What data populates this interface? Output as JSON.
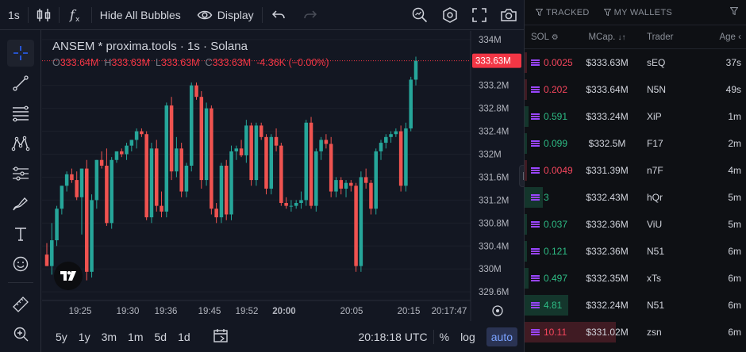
{
  "topbar": {
    "interval": "1s",
    "hide_bubbles": "Hide All Bubbles",
    "display": "Display"
  },
  "legend": {
    "title": "ANSEM * proxima.tools · 1s · Solana",
    "o_label": "O",
    "o_value": "333.64M",
    "h_label": "H",
    "h_value": "333.63M",
    "l_label": "L",
    "l_value": "333.63M",
    "c_label": "C",
    "c_value": "333.63M",
    "change": "-4.36K (−0.00%)"
  },
  "price_axis": {
    "labels": [
      "334M",
      "333.2M",
      "332.8M",
      "332.4M",
      "332M",
      "331.6M",
      "331.2M",
      "330.8M",
      "330.4M",
      "330M",
      "329.6M"
    ],
    "current": "333.63M"
  },
  "time_axis": {
    "labels": [
      "19:25",
      "19:30",
      "19:36",
      "19:45",
      "19:52",
      "20:00",
      "20:05",
      "20:15",
      "20:17:47"
    ]
  },
  "bottombar": {
    "ranges": [
      "5y",
      "1y",
      "3m",
      "1m",
      "5d",
      "1d"
    ],
    "clock": "20:18:18 UTC",
    "percent": "%",
    "log": "log",
    "auto": "auto"
  },
  "panel": {
    "tab_tracked": "TRACKED",
    "tab_wallets": "MY WALLETS",
    "col_sol": "SOL",
    "col_mcap": "MCap.",
    "col_trader": "Trader",
    "col_age": "Age",
    "trades": [
      {
        "sol": "0.0025",
        "mcap": "$333.63M",
        "trader": "sEQ",
        "age": "37s",
        "side": "sell",
        "bar": 0.0
      },
      {
        "sol": "0.202",
        "mcap": "$333.64M",
        "trader": "N5N",
        "age": "49s",
        "side": "sell",
        "bar": 0.0
      },
      {
        "sol": "0.591",
        "mcap": "$333.24M",
        "trader": "XiP",
        "age": "1m",
        "side": "buy",
        "bar": 0.02
      },
      {
        "sol": "0.099",
        "mcap": "$332.5M",
        "trader": "F17",
        "age": "2m",
        "side": "buy",
        "bar": 0.0
      },
      {
        "sol": "0.0049",
        "mcap": "$331.39M",
        "trader": "n7F",
        "age": "4m",
        "side": "sell",
        "bar": 0.0
      },
      {
        "sol": "3",
        "mcap": "$332.43M",
        "trader": "hQr",
        "age": "5m",
        "side": "buy",
        "bar": 0.1
      },
      {
        "sol": "0.037",
        "mcap": "$332.36M",
        "trader": "ViU",
        "age": "5m",
        "side": "buy",
        "bar": 0.0
      },
      {
        "sol": "0.121",
        "mcap": "$332.36M",
        "trader": "N51",
        "age": "6m",
        "side": "buy",
        "bar": 0.0
      },
      {
        "sol": "0.497",
        "mcap": "$332.35M",
        "trader": "xTs",
        "age": "6m",
        "side": "buy",
        "bar": 0.02
      },
      {
        "sol": "4.81",
        "mcap": "$332.24M",
        "trader": "N51",
        "age": "6m",
        "side": "buy",
        "bar": 0.24
      },
      {
        "sol": "10.11",
        "mcap": "$331.02M",
        "trader": "zsn",
        "age": "6m",
        "side": "sell",
        "bar": 0.5
      }
    ]
  },
  "colors": {
    "up": "#26a69a",
    "down": "#ef5350",
    "price_tag": "#f23645"
  },
  "chart_data": {
    "type": "candlestick",
    "y_unit": "M",
    "ylim": [
      329.45,
      334.15
    ],
    "current_price": 333.63,
    "x_ticks": [
      "19:25",
      "19:30",
      "19:36",
      "19:45",
      "19:52",
      "20:00",
      "20:05",
      "20:15",
      "20:17:47"
    ],
    "candles": [
      [
        330.25,
        330.45,
        330.05,
        330.05
      ],
      [
        330.05,
        330.8,
        329.9,
        330.5
      ],
      [
        330.5,
        331.1,
        330.4,
        331.05
      ],
      [
        331.05,
        331.45,
        330.95,
        331.45
      ],
      [
        331.45,
        331.7,
        331.35,
        331.65
      ],
      [
        331.65,
        331.75,
        331.5,
        331.55
      ],
      [
        331.55,
        331.7,
        331.2,
        331.25
      ],
      [
        331.25,
        331.75,
        330.6,
        331.75
      ],
      [
        331.75,
        331.9,
        329.8,
        329.95
      ],
      [
        329.95,
        331.3,
        329.85,
        331.2
      ],
      [
        331.2,
        331.9,
        331.05,
        331.9
      ],
      [
        331.9,
        332.05,
        331.75,
        331.8
      ],
      [
        331.8,
        332.1,
        330.75,
        330.8
      ],
      [
        330.8,
        331.95,
        330.7,
        331.9
      ],
      [
        331.9,
        332.05,
        331.85,
        332.05
      ],
      [
        332.05,
        332.1,
        331.95,
        332.0
      ],
      [
        332.0,
        332.2,
        331.9,
        332.15
      ],
      [
        332.15,
        332.25,
        332.05,
        332.25
      ],
      [
        332.25,
        332.45,
        332.1,
        332.4
      ],
      [
        332.4,
        332.45,
        332.3,
        332.35
      ],
      [
        332.35,
        332.4,
        330.85,
        330.9
      ],
      [
        330.9,
        332.2,
        330.8,
        332.1
      ],
      [
        332.1,
        332.25,
        331.0,
        331.1
      ],
      [
        331.1,
        331.35,
        330.9,
        331.0
      ],
      [
        331.0,
        332.9,
        330.9,
        332.85
      ],
      [
        332.85,
        333.0,
        331.55,
        331.7
      ],
      [
        331.7,
        332.3,
        331.6,
        332.1
      ],
      [
        332.1,
        332.2,
        331.25,
        331.35
      ],
      [
        331.35,
        331.85,
        331.25,
        331.8
      ],
      [
        331.8,
        333.25,
        331.7,
        333.2
      ],
      [
        333.2,
        333.25,
        332.95,
        333.0
      ],
      [
        333.0,
        333.1,
        331.4,
        331.55
      ],
      [
        331.55,
        332.9,
        331.45,
        332.8
      ],
      [
        332.8,
        332.85,
        330.95,
        331.05
      ],
      [
        331.05,
        331.15,
        330.8,
        330.9
      ],
      [
        330.9,
        331.85,
        330.8,
        331.8
      ],
      [
        331.8,
        331.9,
        330.85,
        330.95
      ],
      [
        330.95,
        332.15,
        330.85,
        332.05
      ],
      [
        332.05,
        332.15,
        331.9,
        332.1
      ],
      [
        332.1,
        332.25,
        331.95,
        331.98
      ],
      [
        331.98,
        332.6,
        331.85,
        332.5
      ],
      [
        332.5,
        332.55,
        331.45,
        331.55
      ],
      [
        331.55,
        332.55,
        331.45,
        332.5
      ],
      [
        332.5,
        332.55,
        332.25,
        332.3
      ],
      [
        332.3,
        332.35,
        331.3,
        331.4
      ],
      [
        331.4,
        332.35,
        331.3,
        332.3
      ],
      [
        332.3,
        332.45,
        332.05,
        332.15
      ],
      [
        332.15,
        332.2,
        331.1,
        331.15
      ],
      [
        331.15,
        331.25,
        331.05,
        331.1
      ],
      [
        331.1,
        331.2,
        331.0,
        331.1
      ],
      [
        331.1,
        331.2,
        331.05,
        331.15
      ],
      [
        331.15,
        331.35,
        331.05,
        331.2
      ],
      [
        331.2,
        332.6,
        331.1,
        332.55
      ],
      [
        332.55,
        332.65,
        331.05,
        331.1
      ],
      [
        331.1,
        332.1,
        331.0,
        332.05
      ],
      [
        332.05,
        332.3,
        331.9,
        332.25
      ],
      [
        332.25,
        332.35,
        332.1,
        332.18
      ],
      [
        332.18,
        332.3,
        331.25,
        331.35
      ],
      [
        331.35,
        331.6,
        331.25,
        331.55
      ],
      [
        331.55,
        331.6,
        331.3,
        331.4
      ],
      [
        331.4,
        331.55,
        331.25,
        331.5
      ],
      [
        331.5,
        331.55,
        331.35,
        331.45
      ],
      [
        331.45,
        331.5,
        329.95,
        330.05
      ],
      [
        330.05,
        331.7,
        329.95,
        331.6
      ],
      [
        331.6,
        331.75,
        331.4,
        331.5
      ],
      [
        331.5,
        331.55,
        330.95,
        331.05
      ],
      [
        331.05,
        332.1,
        330.95,
        332.05
      ],
      [
        332.05,
        332.25,
        331.9,
        332.2
      ],
      [
        332.2,
        332.35,
        332.1,
        332.3
      ],
      [
        332.3,
        332.4,
        332.2,
        332.35
      ],
      [
        332.35,
        332.45,
        332.3,
        332.4
      ],
      [
        332.4,
        332.5,
        331.35,
        331.45
      ],
      [
        331.45,
        332.55,
        331.35,
        332.45
      ],
      [
        332.45,
        333.35,
        332.4,
        333.3
      ],
      [
        333.3,
        333.7,
        333.2,
        333.63
      ]
    ]
  }
}
